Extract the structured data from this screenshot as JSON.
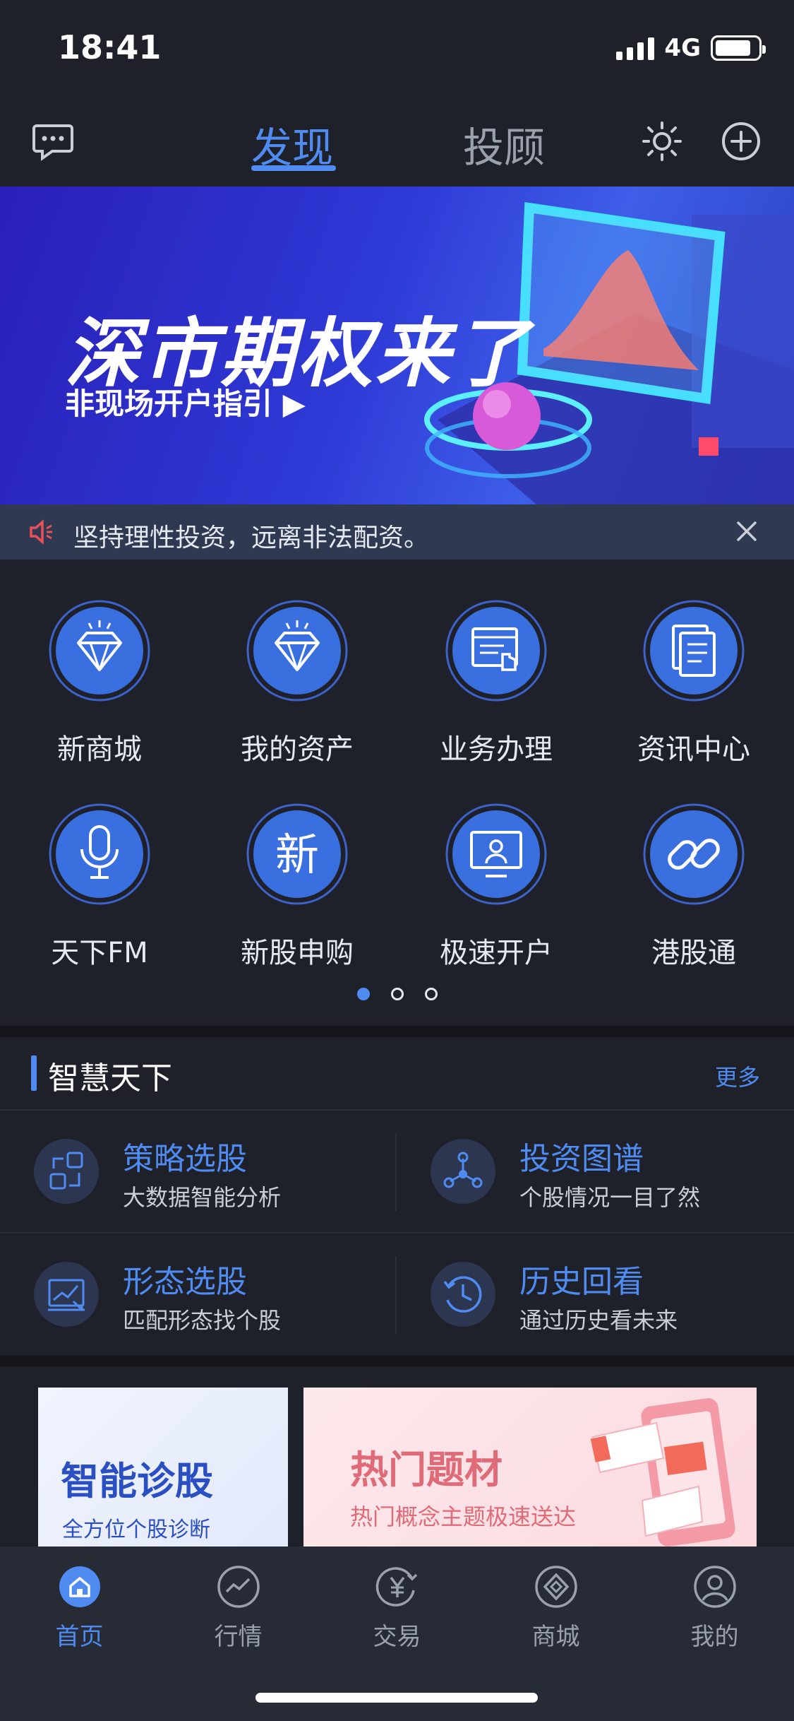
{
  "status_bar": {
    "time": "18:41",
    "network": "4G",
    "battery_level": 0.85
  },
  "top_nav": {
    "tabs": [
      {
        "label": "发现",
        "active": true
      },
      {
        "label": "投顾",
        "active": false
      }
    ],
    "icons": [
      "chat-icon",
      "sun-icon",
      "plus-circle-icon"
    ]
  },
  "banner": {
    "title": "深市期权来了",
    "subtitle": "非现场开户指引 ▶"
  },
  "notice": {
    "text": "坚持理性投资，远离非法配资。",
    "icon": "speaker-icon"
  },
  "grid": {
    "items": [
      {
        "label": "新商城",
        "icon": "diamond-icon"
      },
      {
        "label": "我的资产",
        "icon": "diamond-icon"
      },
      {
        "label": "业务办理",
        "icon": "form-hand-icon"
      },
      {
        "label": "资讯中心",
        "icon": "documents-icon"
      },
      {
        "label": "天下FM",
        "icon": "microphone-icon"
      },
      {
        "label": "新股申购",
        "icon": "new-char-icon",
        "glyph": "新"
      },
      {
        "label": "极速开户",
        "icon": "id-card-icon"
      },
      {
        "label": "港股通",
        "icon": "link-icon"
      }
    ],
    "page_count": 3,
    "active_page": 1
  },
  "smart": {
    "title": "智慧天下",
    "more": "更多",
    "features": [
      {
        "title": "策略选股",
        "desc": "大数据智能分析",
        "icon": "strategy-icon"
      },
      {
        "title": "投资图谱",
        "desc": "个股情况一目了然",
        "icon": "graph-icon"
      },
      {
        "title": "形态选股",
        "desc": "匹配形态找个股",
        "icon": "chart-icon"
      },
      {
        "title": "历史回看",
        "desc": "通过历史看未来",
        "icon": "history-icon"
      }
    ]
  },
  "cards": {
    "left": {
      "title": "智能诊股",
      "subtitle": "全方位个股诊断"
    },
    "right": {
      "title": "热门题材",
      "subtitle": "热门概念主题极速送达"
    }
  },
  "tabbar": {
    "items": [
      {
        "label": "首页",
        "icon": "home-icon",
        "active": true
      },
      {
        "label": "行情",
        "icon": "trend-icon",
        "active": false
      },
      {
        "label": "交易",
        "icon": "yen-icon",
        "active": false
      },
      {
        "label": "商城",
        "icon": "diamond-outline-icon",
        "active": false
      },
      {
        "label": "我的",
        "icon": "profile-icon",
        "active": false
      }
    ]
  },
  "colors": {
    "accent": "#4f8bf0",
    "background": "#1e212a",
    "notice_bg": "#2f3952",
    "card_pink": "#e06b78"
  }
}
